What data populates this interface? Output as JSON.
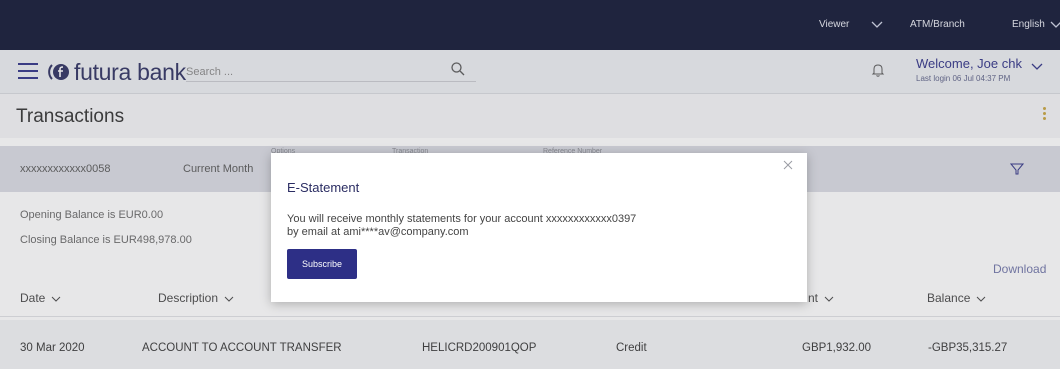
{
  "topbar": {
    "viewer": "Viewer",
    "atm_branch": "ATM/Branch",
    "language": "English"
  },
  "header": {
    "brand": "futura bank",
    "search_placeholder": "Search ...",
    "welcome": "Welcome, Joe chk",
    "last_login": "Last login 06 Jul 04:37 PM"
  },
  "page": {
    "title": "Transactions",
    "filters": {
      "account": "xxxxxxxxxxxx0058",
      "period": "Current Month",
      "label_options": "Options",
      "label_transaction": "Transaction",
      "label_reference": "Reference Number"
    },
    "opening_balance": "Opening Balance is EUR0.00",
    "closing_balance": "Closing Balance is EUR498,978.00",
    "download": "Download",
    "columns": [
      "Date",
      "Description",
      "nt",
      "Balance"
    ],
    "rows": [
      {
        "date": "30 Mar 2020",
        "description": "ACCOUNT TO ACCOUNT TRANSFER",
        "reference": "HELICRD200901QOP",
        "type": "Credit",
        "amount": "GBP1,932.00",
        "balance": "-GBP35,315.27"
      }
    ]
  },
  "modal": {
    "title": "E-Statement",
    "line1": "You will receive monthly statements for your account xxxxxxxxxxxx0397",
    "line2": "by email at ami****av@company.com",
    "subscribe_label": "Subscribe"
  },
  "colors": {
    "topbar": "#0b1230",
    "primary": "#2d2f86",
    "accent": "#c6a33b"
  },
  "icons": [
    "menu-icon",
    "brand-logo-icon",
    "search-icon",
    "bell-icon",
    "chevron-down-icon",
    "filter-icon",
    "kebab-menu-icon",
    "close-icon"
  ]
}
